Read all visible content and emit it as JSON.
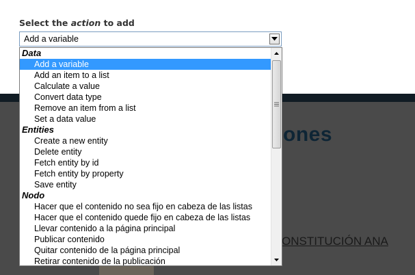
{
  "prompt": {
    "before": "Select the ",
    "emphasis": "action",
    "after": " to add"
  },
  "select": {
    "value": "Add a variable"
  },
  "options": [
    {
      "kind": "group",
      "label": "Data"
    },
    {
      "kind": "option",
      "label": "Add a variable",
      "selected": true
    },
    {
      "kind": "option",
      "label": "Add an item to a list"
    },
    {
      "kind": "option",
      "label": "Calculate a value"
    },
    {
      "kind": "option",
      "label": "Convert data type"
    },
    {
      "kind": "option",
      "label": "Remove an item from a list"
    },
    {
      "kind": "option",
      "label": "Set a data value"
    },
    {
      "kind": "group",
      "label": "Entities"
    },
    {
      "kind": "option",
      "label": "Create a new entity"
    },
    {
      "kind": "option",
      "label": "Delete entity"
    },
    {
      "kind": "option",
      "label": "Fetch entity by id"
    },
    {
      "kind": "option",
      "label": "Fetch entity by property"
    },
    {
      "kind": "option",
      "label": "Save entity"
    },
    {
      "kind": "group",
      "label": "Nodo"
    },
    {
      "kind": "option",
      "label": "Hacer que el contenido no sea fijo en cabeza de las listas"
    },
    {
      "kind": "option",
      "label": "Hacer que el contenido quede fijo en cabeza de las listas"
    },
    {
      "kind": "option",
      "label": "Llevar contenido a la página principal"
    },
    {
      "kind": "option",
      "label": "Publicar contenido"
    },
    {
      "kind": "option",
      "label": "Quitar contenido de la página principal"
    },
    {
      "kind": "option",
      "label": "Retirar contenido de la publicación"
    }
  ],
  "background": {
    "heading": "ones",
    "link": "ONSTITUCIÓN ANA"
  },
  "colors": {
    "selection": "#3399ff",
    "page_dark": "#4a4a4a",
    "header_bar": "#111c24",
    "heading_text": "#0e2535"
  }
}
